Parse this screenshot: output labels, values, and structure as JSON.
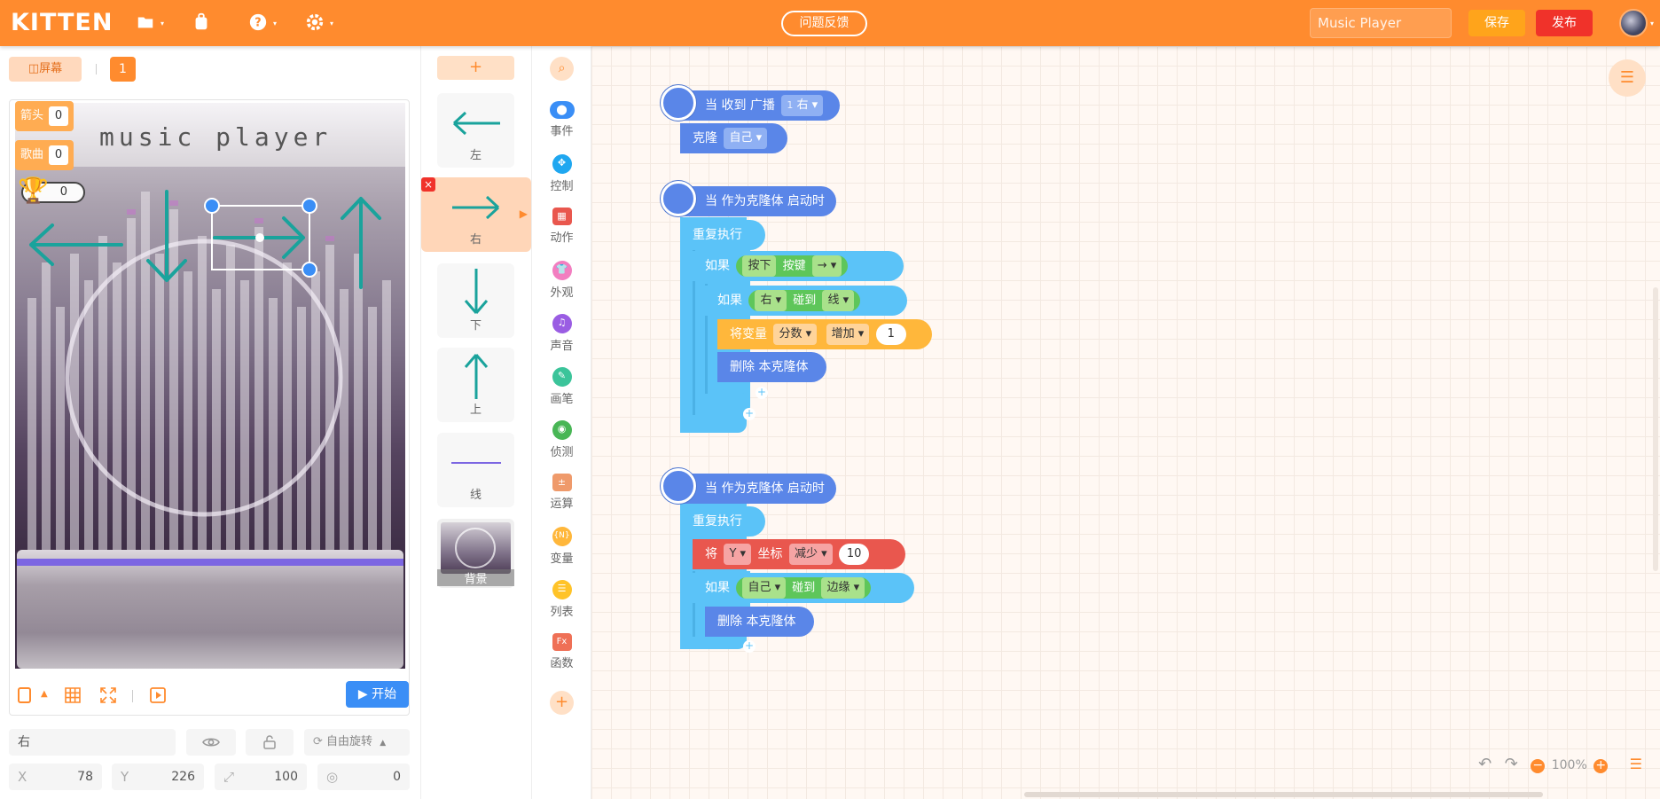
{
  "header": {
    "logo": "KITTEN",
    "feedback": "问题反馈",
    "project_name": "Music Player",
    "save": "保存",
    "publish": "发布"
  },
  "stage": {
    "screen_label": "屏幕",
    "screen_number": "1",
    "title": "music player",
    "variables": [
      {
        "name": "箭头",
        "value": "0"
      },
      {
        "name": "歌曲",
        "value": "0"
      }
    ],
    "score": "0",
    "start": "开始"
  },
  "props": {
    "sprite_name": "右",
    "rotation": "自由旋转",
    "x_label": "X",
    "x": "78",
    "y_label": "Y",
    "y": "226",
    "size": "100",
    "direction": "0"
  },
  "sprites": [
    {
      "name": "左",
      "icon": "arrow-left-icon"
    },
    {
      "name": "右",
      "icon": "arrow-right-icon",
      "active": true
    },
    {
      "name": "下",
      "icon": "arrow-down-icon"
    },
    {
      "name": "上",
      "icon": "arrow-up-icon"
    },
    {
      "name": "线",
      "icon": "line-icon"
    },
    {
      "name": "背景",
      "icon": "background-thumb"
    }
  ],
  "categories": [
    {
      "name": "事件",
      "color": "#3a8ef6"
    },
    {
      "name": "控制",
      "color": "#1fa7f0"
    },
    {
      "name": "动作",
      "color": "#e9574e"
    },
    {
      "name": "外观",
      "color": "#f27ec0"
    },
    {
      "name": "声音",
      "color": "#9a5de3"
    },
    {
      "name": "画笔",
      "color": "#3bc49a"
    },
    {
      "name": "侦测",
      "color": "#48b655"
    },
    {
      "name": "运算",
      "color": "#ef9a6b"
    },
    {
      "name": "变量",
      "color": "#ffb73b"
    },
    {
      "name": "列表",
      "color": "#ffc328"
    },
    {
      "name": "函数",
      "color": "#ef7056"
    }
  ],
  "blocks": {
    "s1_hat": "当 收到 广播",
    "s1_broadcast_num": "1",
    "s1_broadcast": "右",
    "s1_clone": "克隆",
    "s1_clone_target": "自己",
    "s2_hat": "当 作为克隆体 启动时",
    "repeat": "重复执行",
    "if": "如果",
    "s2_press": "按下",
    "s2_key": "按键",
    "s2_key_val": "→",
    "s2_obj": "右",
    "s2_touch": "碰到",
    "s2_target": "线",
    "s2_setvar": "将变量",
    "s2_var": "分数",
    "s2_op": "增加",
    "s2_amount": "1",
    "delete_clone": "删除 本克隆体",
    "s3_hat": "当 作为克隆体 启动时",
    "s3_set": "将",
    "s3_axis": "Y",
    "s3_coord": "坐标",
    "s3_op": "减少",
    "s3_amount": "10",
    "s3_obj": "自己",
    "s3_touch": "碰到",
    "s3_target": "边缘"
  },
  "workspace": {
    "zoom": "100%"
  }
}
